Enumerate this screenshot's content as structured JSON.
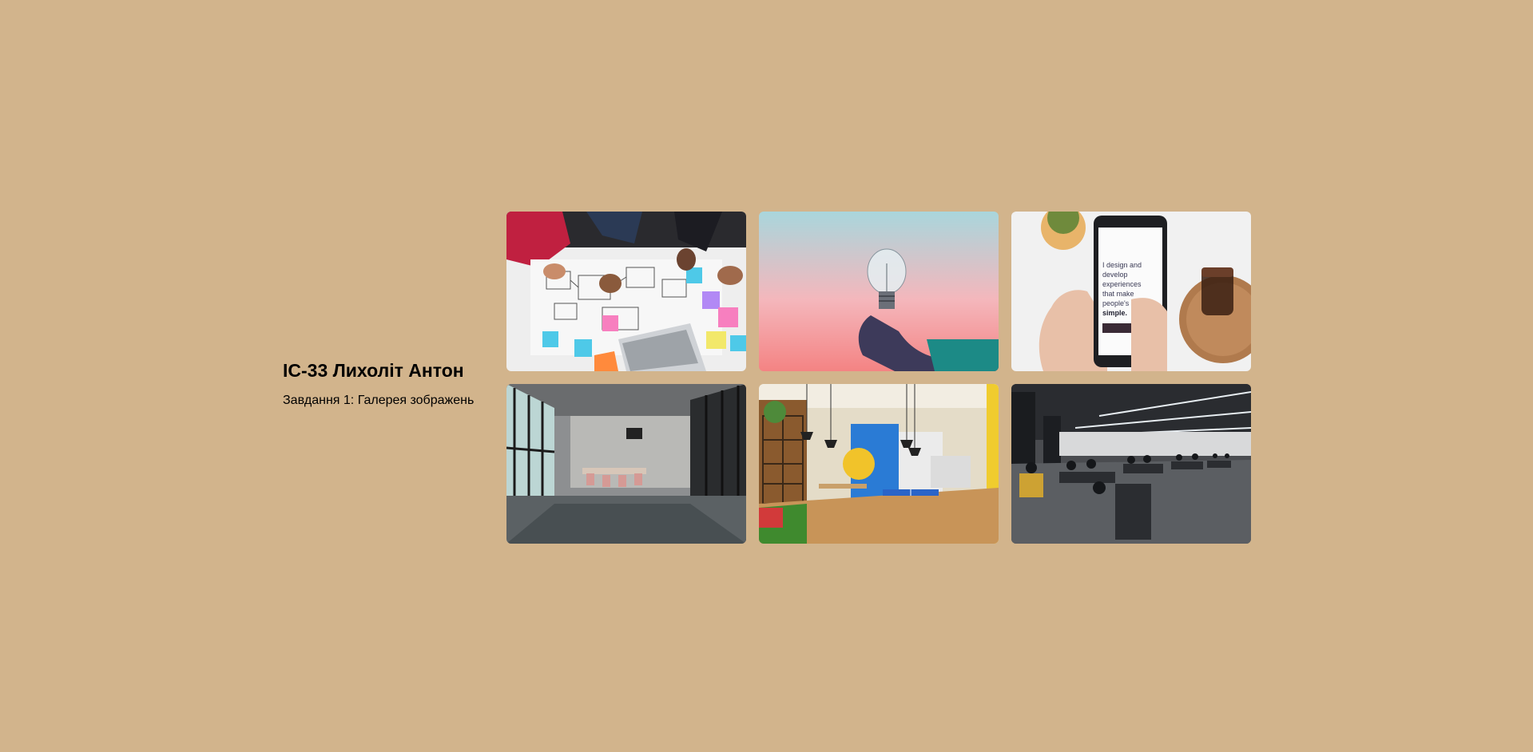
{
  "header": {
    "title": "ІС-33 Лихоліт Антон",
    "subtitle": "Завдання 1: Галерея зображень"
  },
  "gallery": {
    "images": [
      {
        "subject": "team-sketching-wireframes"
      },
      {
        "subject": "hand-holding-lightbulb"
      },
      {
        "subject": "phone-with-website"
      },
      {
        "subject": "glass-office-meeting-room"
      },
      {
        "subject": "colorful-office-pingpong"
      },
      {
        "subject": "large-open-plan-office"
      }
    ],
    "phone_text": {
      "line1": "I design and",
      "line2": "develop",
      "line3": "experiences",
      "line4": "that make",
      "line5": "people's lives",
      "line6": "simple."
    }
  },
  "colors": {
    "background": "#d2b48c",
    "text": "#000000"
  }
}
